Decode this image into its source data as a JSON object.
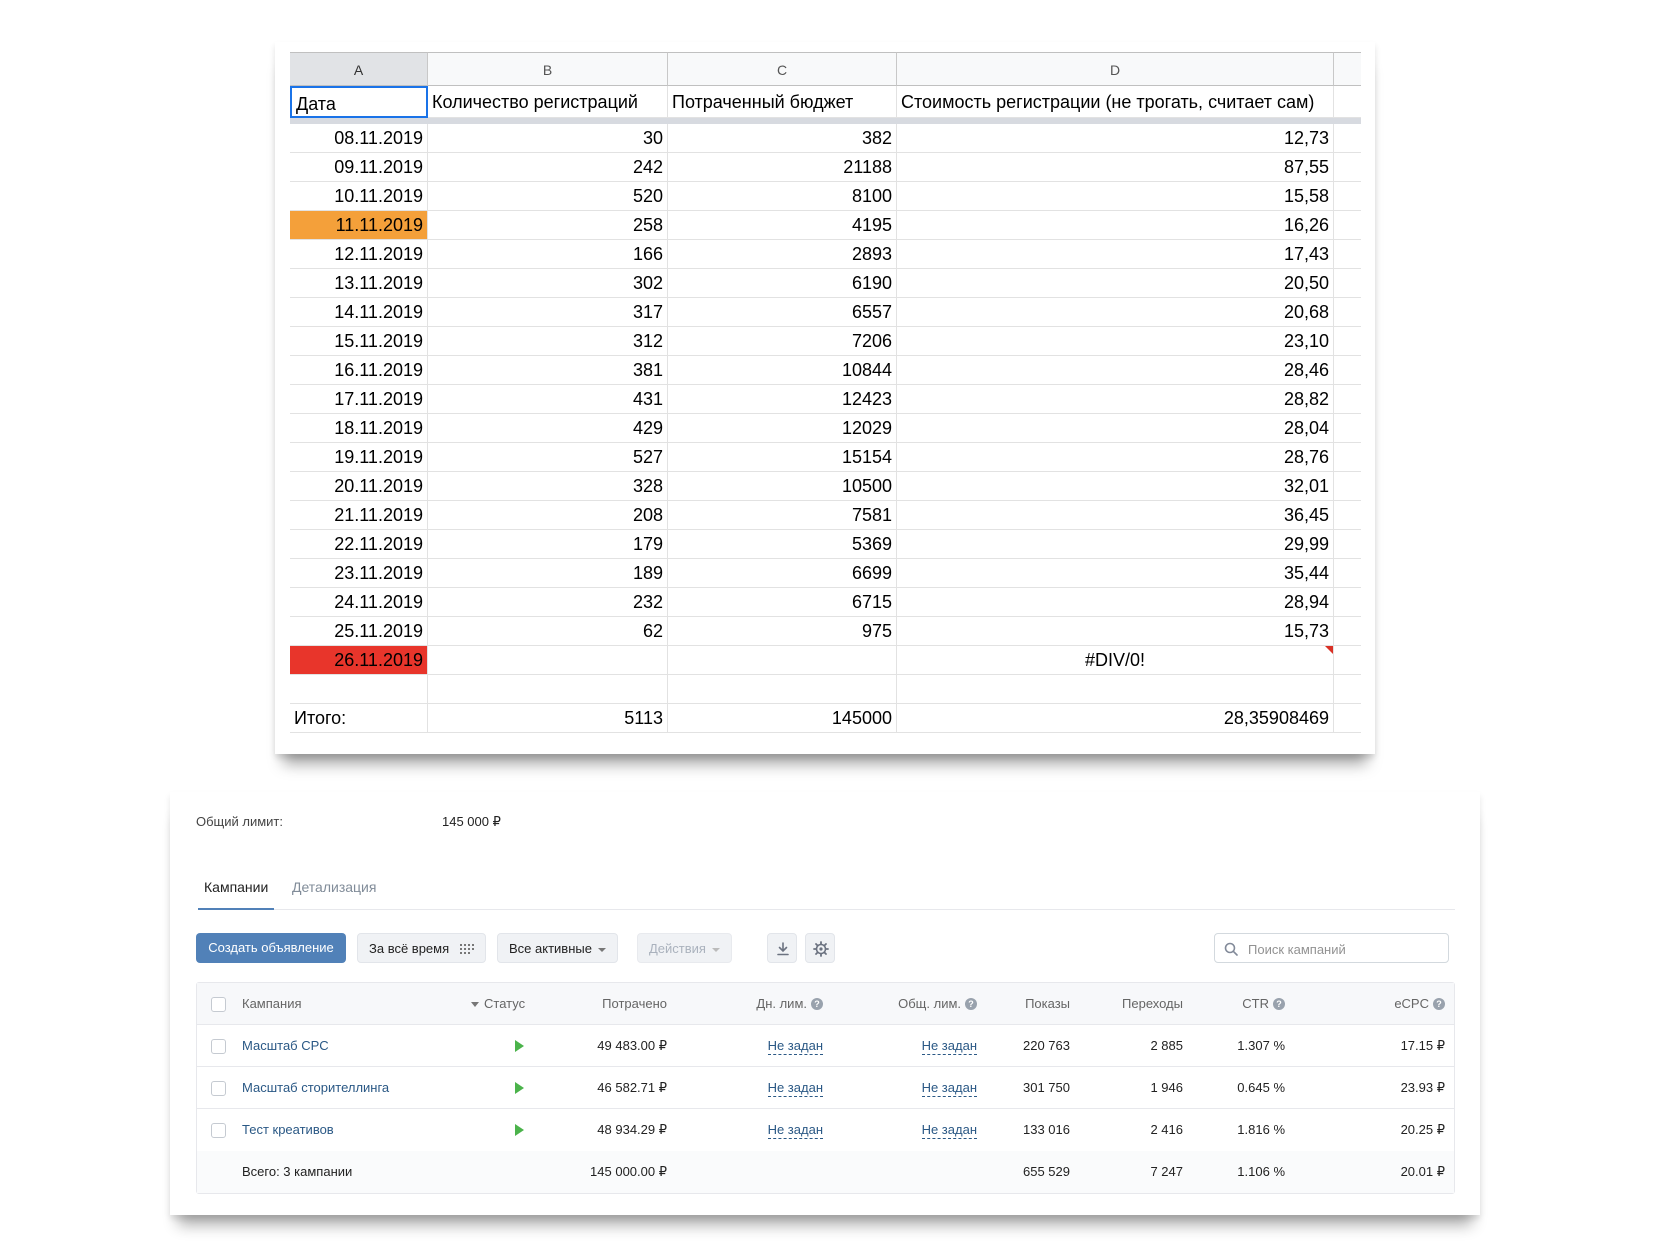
{
  "sheet": {
    "col_headers": [
      "A",
      "B",
      "C",
      "D"
    ],
    "titles": {
      "a": "Дата",
      "b": "Количество регистраций",
      "c": "Потраченный бюджет",
      "d": "Стоимость регистрации (не трогать, считает сам)"
    },
    "rows": [
      {
        "date": "08.11.2019",
        "regs": "30",
        "budget": "382",
        "cost": "12,73"
      },
      {
        "date": "09.11.2019",
        "regs": "242",
        "budget": "21188",
        "cost": "87,55"
      },
      {
        "date": "10.11.2019",
        "regs": "520",
        "budget": "8100",
        "cost": "15,58"
      },
      {
        "date": "11.11.2019",
        "regs": "258",
        "budget": "4195",
        "cost": "16,26",
        "highlight": "#f4a03a"
      },
      {
        "date": "12.11.2019",
        "regs": "166",
        "budget": "2893",
        "cost": "17,43"
      },
      {
        "date": "13.11.2019",
        "regs": "302",
        "budget": "6190",
        "cost": "20,50"
      },
      {
        "date": "14.11.2019",
        "regs": "317",
        "budget": "6557",
        "cost": "20,68"
      },
      {
        "date": "15.11.2019",
        "regs": "312",
        "budget": "7206",
        "cost": "23,10"
      },
      {
        "date": "16.11.2019",
        "regs": "381",
        "budget": "10844",
        "cost": "28,46"
      },
      {
        "date": "17.11.2019",
        "regs": "431",
        "budget": "12423",
        "cost": "28,82"
      },
      {
        "date": "18.11.2019",
        "regs": "429",
        "budget": "12029",
        "cost": "28,04"
      },
      {
        "date": "19.11.2019",
        "regs": "527",
        "budget": "15154",
        "cost": "28,76"
      },
      {
        "date": "20.11.2019",
        "regs": "328",
        "budget": "10500",
        "cost": "32,01"
      },
      {
        "date": "21.11.2019",
        "regs": "208",
        "budget": "7581",
        "cost": "36,45"
      },
      {
        "date": "22.11.2019",
        "regs": "179",
        "budget": "5369",
        "cost": "29,99"
      },
      {
        "date": "23.11.2019",
        "regs": "189",
        "budget": "6699",
        "cost": "35,44"
      },
      {
        "date": "24.11.2019",
        "regs": "232",
        "budget": "6715",
        "cost": "28,94"
      },
      {
        "date": "25.11.2019",
        "regs": "62",
        "budget": "975",
        "cost": "15,73"
      }
    ],
    "error_row": {
      "date": "26.11.2019",
      "cost": "#DIV/0!",
      "highlight": "#e8352b"
    },
    "total": {
      "label": "Итого:",
      "regs": "5113",
      "budget": "145000",
      "cost": "28,35908469"
    }
  },
  "cabinet": {
    "limit_label": "Общий лимит:",
    "limit_value": "145 000 ₽",
    "tabs": [
      {
        "label": "Кампании",
        "active": true
      },
      {
        "label": "Детализация",
        "active": false
      }
    ],
    "toolbar": {
      "create": "Создать объявление",
      "period": "За всё время",
      "filter": "Все активные",
      "actions": "Действия",
      "search_placeholder": "Поиск кампаний"
    },
    "columns": {
      "campaign": "Кампания",
      "status": "Статус",
      "spent": "Потрачено",
      "day_limit": "Дн. лим.",
      "total_limit": "Общ. лим.",
      "impressions": "Показы",
      "clicks": "Переходы",
      "ctr": "CTR",
      "ecpc": "eCPC"
    },
    "campaigns": [
      {
        "name": "Масштаб CPC",
        "spent": "49 483.00 ₽",
        "day_limit": "Не задан",
        "total_limit": "Не задан",
        "impressions": "220 763",
        "clicks": "2 885",
        "ctr": "1.307 %",
        "ecpc": "17.15 ₽"
      },
      {
        "name": "Масштаб сторителлинга",
        "spent": "46 582.71 ₽",
        "day_limit": "Не задан",
        "total_limit": "Не задан",
        "impressions": "301 750",
        "clicks": "1 946",
        "ctr": "0.645 %",
        "ecpc": "23.93 ₽"
      },
      {
        "name": "Тест креативов",
        "spent": "48 934.29 ₽",
        "day_limit": "Не задан",
        "total_limit": "Не задан",
        "impressions": "133 016",
        "clicks": "2 416",
        "ctr": "1.816 %",
        "ecpc": "20.25 ₽"
      }
    ],
    "total": {
      "label": "Всего: 3 кампании",
      "spent": "145 000.00 ₽",
      "impressions": "655 529",
      "clicks": "7 247",
      "ctr": "1.106 %",
      "ecpc": "20.01 ₽"
    }
  }
}
